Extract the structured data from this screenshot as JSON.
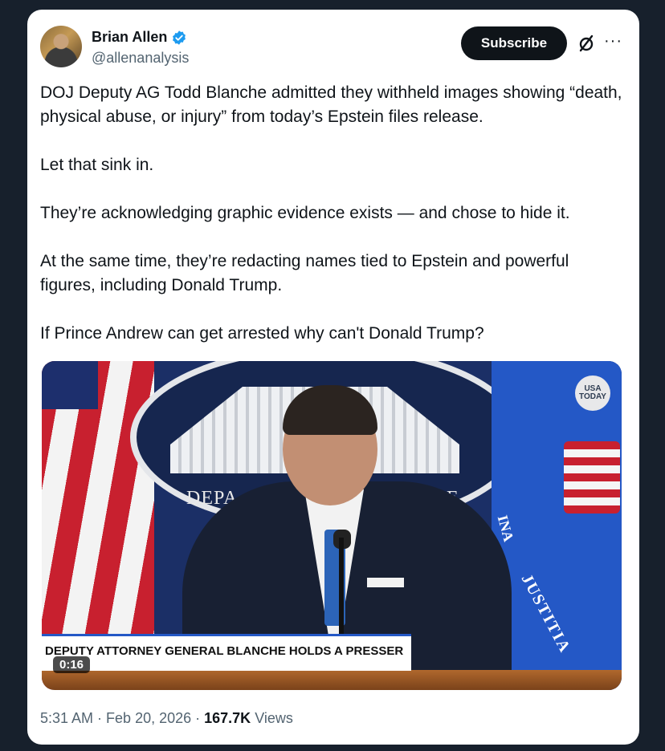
{
  "author": {
    "name": "Brian Allen",
    "handle": "@allenanalysis",
    "verified": true
  },
  "header": {
    "subscribe_label": "Subscribe",
    "grok_icon": "grok-slash-circle-icon",
    "more_icon": "more-ellipsis-icon",
    "more_glyph": "···"
  },
  "tweet": {
    "paragraphs": [
      "DOJ Deputy AG Todd Blanche admitted they withheld images showing “death, physical abuse, or injury” from today’s Epstein files release.",
      "Let that sink in.",
      "They’re acknowledging graphic evidence exists — and chose to hide it.",
      "At the same time, they’re redacting names tied to Epstein and powerful figures, including Donald Trump.",
      "If Prince Andrew can get arrested why can't Donald Trump?"
    ]
  },
  "media": {
    "type": "video",
    "duration": "0:16",
    "caption": "DEPUTY ATTORNEY GENERAL BLANCHE HOLDS A PRESSER",
    "badge_line1": "USA",
    "badge_line2": "TODAY",
    "seal_text_left": "DEPA",
    "seal_text_right": "CE",
    "flag_text_1": "INA",
    "flag_text_2": "JUSTITIA"
  },
  "meta": {
    "time": "5:31 AM",
    "separator": " · ",
    "date": "Feb 20, 2026",
    "views_count": "167.7K",
    "views_label": " Views"
  },
  "colors": {
    "background": "#17202c",
    "card": "#ffffff",
    "verified_blue": "#1d9bf0",
    "text_primary": "#0f1419",
    "text_secondary": "#536471"
  }
}
